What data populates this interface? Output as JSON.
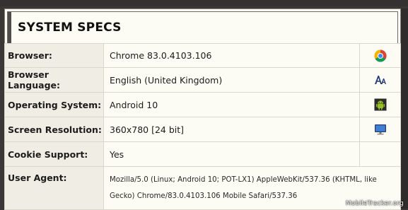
{
  "header": {
    "title": "SYSTEM SPECS"
  },
  "rows": [
    {
      "label": "Browser:",
      "value": "Chrome 83.0.4103.106",
      "icon": "chrome-icon"
    },
    {
      "label": "Browser Language:",
      "value": "English (United Kingdom)",
      "icon": "font-size-icon"
    },
    {
      "label": "Operating System:",
      "value": "Android 10",
      "icon": "android-icon"
    },
    {
      "label": "Screen Resolution:",
      "value": "360x780 [24 bit]",
      "icon": "monitor-icon"
    },
    {
      "label": "Cookie Support:",
      "value": "Yes",
      "icon": ""
    }
  ],
  "user_agent": {
    "label": "User Agent:",
    "value": "Mozilla/5.0 (Linux; Android 10; POT-LX1) AppleWebKit/537.36 (KHTML, like Gecko) Chrome/83.0.4103.106 Mobile Safari/537.36"
  },
  "watermark": "MobileTracker.org",
  "colors": {
    "background": "#3a3836",
    "card": "#fdfcf4",
    "label_bg": "#efede4"
  }
}
